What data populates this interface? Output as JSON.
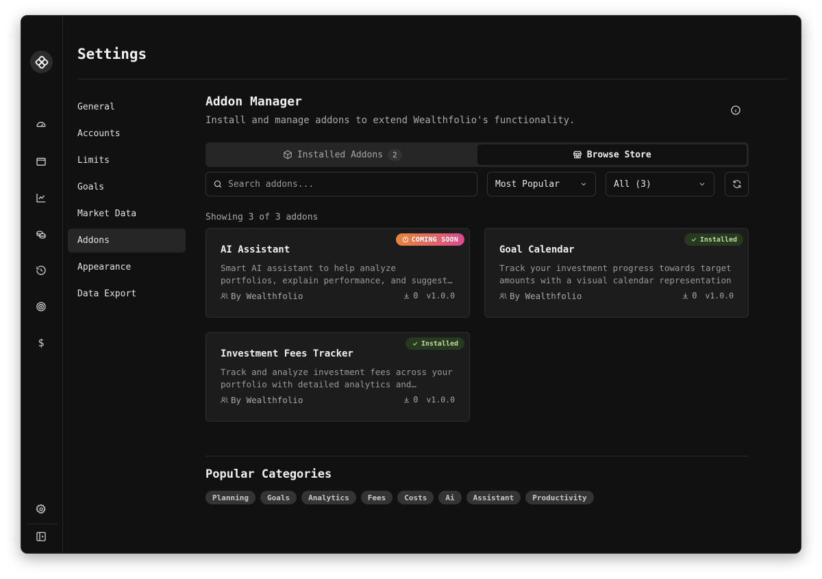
{
  "app": {
    "page_title": "Settings"
  },
  "rail": {
    "icons": [
      "dashboard-icon",
      "wallet-icon",
      "chart-icon",
      "coins-icon",
      "history-icon",
      "target-icon",
      "dollar-icon"
    ],
    "dollar_glyph": "$",
    "bottom_icons": [
      "settings-icon",
      "sidebar-toggle-icon"
    ]
  },
  "settings_nav": {
    "items": [
      {
        "label": "General"
      },
      {
        "label": "Accounts"
      },
      {
        "label": "Limits"
      },
      {
        "label": "Goals"
      },
      {
        "label": "Market Data"
      },
      {
        "label": "Addons",
        "active": true
      },
      {
        "label": "Appearance"
      },
      {
        "label": "Data Export"
      }
    ]
  },
  "addon_manager": {
    "title": "Addon Manager",
    "description": "Install and manage addons to extend Wealthfolio's functionality.",
    "tabs": {
      "installed_label": "Installed Addons",
      "installed_count": "2",
      "browse_label": "Browse Store",
      "active": "browse"
    },
    "search": {
      "placeholder": "Search addons...",
      "value": ""
    },
    "sort_select": {
      "value": "Most Popular"
    },
    "filter_select": {
      "value": "All (3)"
    },
    "showing_text": "Showing 3 of 3 addons",
    "addons": [
      {
        "name": "AI Assistant",
        "description": "Smart AI assistant to help analyze portfolios, explain performance, and suggest improvements",
        "author": "By Wealthfolio",
        "downloads": "0",
        "version": "v1.0.0",
        "badge": "COMING SOON"
      },
      {
        "name": "Goal Calendar",
        "description": "Track your investment progress towards target amounts with a visual calendar representation",
        "author": "By Wealthfolio",
        "downloads": "0",
        "version": "v1.0.0",
        "badge": "Installed"
      },
      {
        "name": "Investment Fees Tracker",
        "description": "Track and analyze investment fees across your portfolio with detailed analytics and insights",
        "author": "By Wealthfolio",
        "downloads": "0",
        "version": "v1.0.0",
        "badge": "Installed"
      }
    ],
    "categories_title": "Popular Categories",
    "categories": [
      "Planning",
      "Goals",
      "Analytics",
      "Fees",
      "Costs",
      "Ai",
      "Assistant",
      "Productivity"
    ]
  },
  "colors": {
    "background": "#111111",
    "card": "#1c1c1c",
    "active_nav": "#262626",
    "badge_installed_bg": "#263a1f",
    "badge_soon_start": "#e8853a",
    "badge_soon_end": "#d94b8e"
  }
}
